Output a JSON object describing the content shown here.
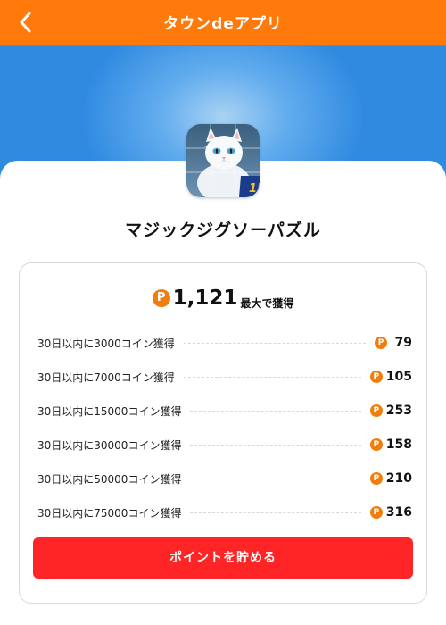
{
  "header": {
    "title": "タウンdeアプリ",
    "back_icon": "chevron-left-icon"
  },
  "app": {
    "name": "マジックジグソーパズル",
    "icon": "cat-jigsaw-app-icon",
    "badge": "15"
  },
  "reward": {
    "coin_glyph": "P",
    "total": "1,121",
    "total_suffix": "最大で獲得",
    "tasks": [
      {
        "label": "30日以内に3000コイン獲得",
        "points": "79"
      },
      {
        "label": "30日以内に7000コイン獲得",
        "points": "105"
      },
      {
        "label": "30日以内に15000コイン獲得",
        "points": "253"
      },
      {
        "label": "30日以内に30000コイン獲得",
        "points": "158"
      },
      {
        "label": "30日以内に50000コイン獲得",
        "points": "210"
      },
      {
        "label": "30日以内に75000コイン獲得",
        "points": "316"
      }
    ]
  },
  "cta": {
    "label": "ポイントを貯める"
  },
  "colors": {
    "header": "#ff7a0a",
    "coin": "#f07d0c",
    "cta": "#ff2526",
    "hero": "#2f8ae0"
  }
}
